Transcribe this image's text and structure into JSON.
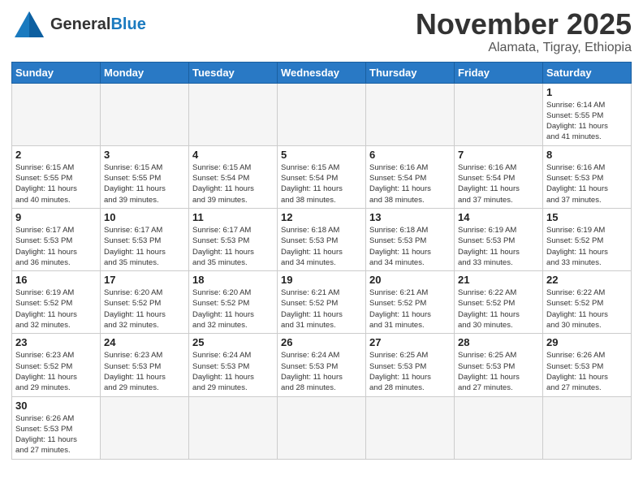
{
  "logo": {
    "text_general": "General",
    "text_blue": "Blue"
  },
  "header": {
    "month": "November 2025",
    "location": "Alamata, Tigray, Ethiopia"
  },
  "weekdays": [
    "Sunday",
    "Monday",
    "Tuesday",
    "Wednesday",
    "Thursday",
    "Friday",
    "Saturday"
  ],
  "weeks": [
    [
      {
        "day": null,
        "info": null
      },
      {
        "day": null,
        "info": null
      },
      {
        "day": null,
        "info": null
      },
      {
        "day": null,
        "info": null
      },
      {
        "day": null,
        "info": null
      },
      {
        "day": null,
        "info": null
      },
      {
        "day": "1",
        "info": "Sunrise: 6:14 AM\nSunset: 5:55 PM\nDaylight: 11 hours\nand 41 minutes."
      }
    ],
    [
      {
        "day": "2",
        "info": "Sunrise: 6:15 AM\nSunset: 5:55 PM\nDaylight: 11 hours\nand 40 minutes."
      },
      {
        "day": "3",
        "info": "Sunrise: 6:15 AM\nSunset: 5:55 PM\nDaylight: 11 hours\nand 39 minutes."
      },
      {
        "day": "4",
        "info": "Sunrise: 6:15 AM\nSunset: 5:54 PM\nDaylight: 11 hours\nand 39 minutes."
      },
      {
        "day": "5",
        "info": "Sunrise: 6:15 AM\nSunset: 5:54 PM\nDaylight: 11 hours\nand 38 minutes."
      },
      {
        "day": "6",
        "info": "Sunrise: 6:16 AM\nSunset: 5:54 PM\nDaylight: 11 hours\nand 38 minutes."
      },
      {
        "day": "7",
        "info": "Sunrise: 6:16 AM\nSunset: 5:54 PM\nDaylight: 11 hours\nand 37 minutes."
      },
      {
        "day": "8",
        "info": "Sunrise: 6:16 AM\nSunset: 5:53 PM\nDaylight: 11 hours\nand 37 minutes."
      }
    ],
    [
      {
        "day": "9",
        "info": "Sunrise: 6:17 AM\nSunset: 5:53 PM\nDaylight: 11 hours\nand 36 minutes."
      },
      {
        "day": "10",
        "info": "Sunrise: 6:17 AM\nSunset: 5:53 PM\nDaylight: 11 hours\nand 35 minutes."
      },
      {
        "day": "11",
        "info": "Sunrise: 6:17 AM\nSunset: 5:53 PM\nDaylight: 11 hours\nand 35 minutes."
      },
      {
        "day": "12",
        "info": "Sunrise: 6:18 AM\nSunset: 5:53 PM\nDaylight: 11 hours\nand 34 minutes."
      },
      {
        "day": "13",
        "info": "Sunrise: 6:18 AM\nSunset: 5:53 PM\nDaylight: 11 hours\nand 34 minutes."
      },
      {
        "day": "14",
        "info": "Sunrise: 6:19 AM\nSunset: 5:53 PM\nDaylight: 11 hours\nand 33 minutes."
      },
      {
        "day": "15",
        "info": "Sunrise: 6:19 AM\nSunset: 5:52 PM\nDaylight: 11 hours\nand 33 minutes."
      }
    ],
    [
      {
        "day": "16",
        "info": "Sunrise: 6:19 AM\nSunset: 5:52 PM\nDaylight: 11 hours\nand 32 minutes."
      },
      {
        "day": "17",
        "info": "Sunrise: 6:20 AM\nSunset: 5:52 PM\nDaylight: 11 hours\nand 32 minutes."
      },
      {
        "day": "18",
        "info": "Sunrise: 6:20 AM\nSunset: 5:52 PM\nDaylight: 11 hours\nand 32 minutes."
      },
      {
        "day": "19",
        "info": "Sunrise: 6:21 AM\nSunset: 5:52 PM\nDaylight: 11 hours\nand 31 minutes."
      },
      {
        "day": "20",
        "info": "Sunrise: 6:21 AM\nSunset: 5:52 PM\nDaylight: 11 hours\nand 31 minutes."
      },
      {
        "day": "21",
        "info": "Sunrise: 6:22 AM\nSunset: 5:52 PM\nDaylight: 11 hours\nand 30 minutes."
      },
      {
        "day": "22",
        "info": "Sunrise: 6:22 AM\nSunset: 5:52 PM\nDaylight: 11 hours\nand 30 minutes."
      }
    ],
    [
      {
        "day": "23",
        "info": "Sunrise: 6:23 AM\nSunset: 5:52 PM\nDaylight: 11 hours\nand 29 minutes."
      },
      {
        "day": "24",
        "info": "Sunrise: 6:23 AM\nSunset: 5:53 PM\nDaylight: 11 hours\nand 29 minutes."
      },
      {
        "day": "25",
        "info": "Sunrise: 6:24 AM\nSunset: 5:53 PM\nDaylight: 11 hours\nand 29 minutes."
      },
      {
        "day": "26",
        "info": "Sunrise: 6:24 AM\nSunset: 5:53 PM\nDaylight: 11 hours\nand 28 minutes."
      },
      {
        "day": "27",
        "info": "Sunrise: 6:25 AM\nSunset: 5:53 PM\nDaylight: 11 hours\nand 28 minutes."
      },
      {
        "day": "28",
        "info": "Sunrise: 6:25 AM\nSunset: 5:53 PM\nDaylight: 11 hours\nand 27 minutes."
      },
      {
        "day": "29",
        "info": "Sunrise: 6:26 AM\nSunset: 5:53 PM\nDaylight: 11 hours\nand 27 minutes."
      }
    ],
    [
      {
        "day": "30",
        "info": "Sunrise: 6:26 AM\nSunset: 5:53 PM\nDaylight: 11 hours\nand 27 minutes."
      },
      {
        "day": null,
        "info": null
      },
      {
        "day": null,
        "info": null
      },
      {
        "day": null,
        "info": null
      },
      {
        "day": null,
        "info": null
      },
      {
        "day": null,
        "info": null
      },
      {
        "day": null,
        "info": null
      }
    ]
  ]
}
